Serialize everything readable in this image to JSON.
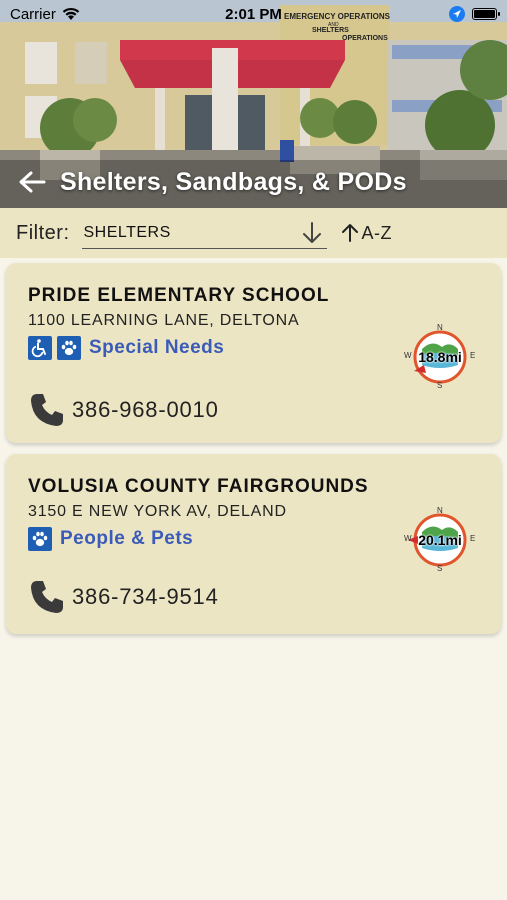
{
  "status_bar": {
    "carrier": "Carrier",
    "time": "2:01 PM"
  },
  "header": {
    "title": "Shelters, Sandbags, & PODs",
    "sign_text": "EMERGENCY OPERATIONS",
    "sign_text_2": "AND",
    "sign_text_3": "SHELTERS",
    "sign_text_4": "OPERATIONS"
  },
  "filter": {
    "label": "Filter:",
    "selected": "SHELTERS",
    "sort_label": "A-Z"
  },
  "shelters": [
    {
      "name": "PRIDE ELEMENTARY SCHOOL",
      "address": "1100 LEARNING LANE, DELTONA",
      "tag_icons": [
        "wheelchair-icon",
        "paw-icon"
      ],
      "tag_label": "Special Needs",
      "phone": "386-968-0010",
      "distance": "18.8mi",
      "compass": {
        "n": "N",
        "s": "S",
        "e": "E",
        "w": "W"
      }
    },
    {
      "name": "VOLUSIA COUNTY FAIRGROUNDS",
      "address": "3150 E NEW YORK AV, DELAND",
      "tag_icons": [
        "paw-icon"
      ],
      "tag_label": "People & Pets",
      "phone": "386-734-9514",
      "distance": "20.1mi",
      "compass": {
        "n": "N",
        "s": "S",
        "e": "E",
        "w": "W"
      }
    }
  ],
  "colors": {
    "card_bg": "#ece5c4",
    "page_bg": "#f7f5ea",
    "tag_text": "#3b5bb8",
    "tag_icon_bg": "#1e5fb4",
    "compass_ring": "#e0552c"
  }
}
